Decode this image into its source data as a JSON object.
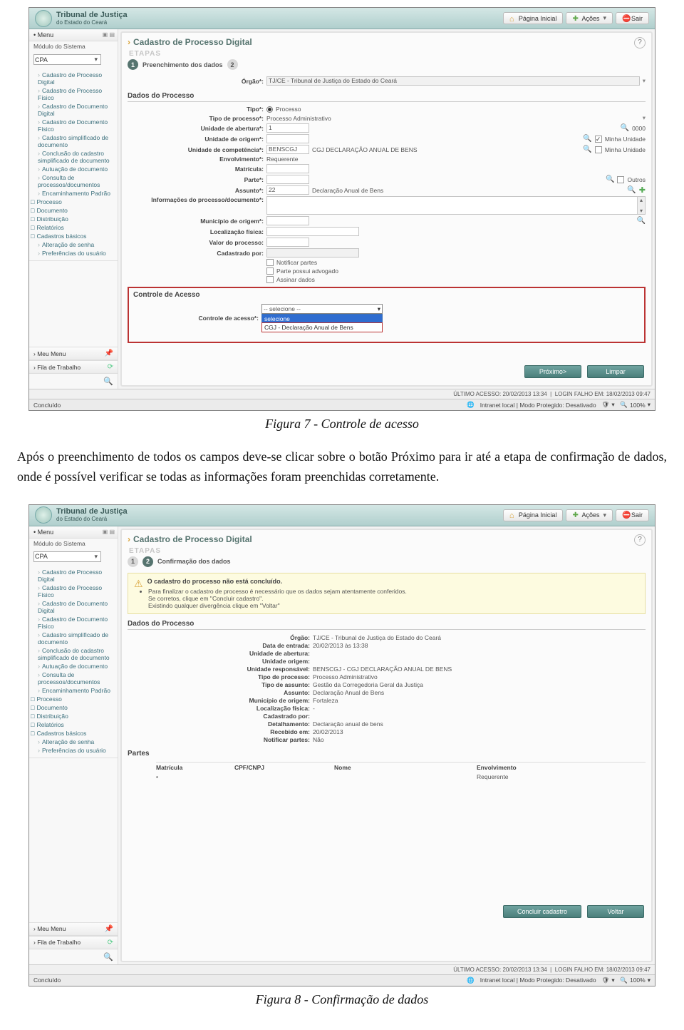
{
  "common": {
    "orgTitle": "Tribunal de Justiça",
    "orgSub": "do Estado do Ceará",
    "btnHome": "Página Inicial",
    "btnAcoes": "Ações",
    "btnSair": "Sair",
    "sbMenu": "Menu",
    "sbModulo": "Módulo do Sistema",
    "sbModuloVal": "CPA",
    "menu": {
      "a": "Cadastro de Processo Digital",
      "b": "Cadastro de Processo Físico",
      "c": "Cadastro de Documento Digital",
      "d": "Cadastro de Documento Físico",
      "e": "Cadastro simplificado de documento",
      "f": "Conclusão do cadastro simplificado de documento",
      "g": "Autuação de documento",
      "h": "Consulta de processos/documentos",
      "i": "Encaminhamento Padrão",
      "j": "Processo",
      "k": "Documento",
      "l": "Distribuição",
      "m": "Relatórios",
      "n": "Cadastros básicos",
      "o": "Alteração de senha",
      "p": "Preferências do usuário"
    },
    "sbMeuMenu": "Meu Menu",
    "sbFila": "Fila de Trabalho",
    "pageTitle": "Cadastro de Processo Digital",
    "etapas": "ETAPAS",
    "statusLeft": "Concluído",
    "statusRight1": "ÚLTIMO ACESSO: 20/02/2013 13:34",
    "statusRight2": "LOGIN FALHO EM: 18/02/2013 09:47",
    "ieMid": "Intranet local | Modo Protegido: Desativado",
    "ieZoom": "100%"
  },
  "fig7": {
    "stepLabel": "Preenchimento dos dados",
    "lblOrgao": "Órgão*:",
    "valOrgao": "TJ/CE - Tribunal de Justiça do Estado do Ceará",
    "secDados": "Dados do Processo",
    "lblTipo": "Tipo*:",
    "valTipo": "Processo",
    "lblTipoProc": "Tipo de processo*:",
    "valTipoProc": "Processo Administrativo",
    "lblUnAb": "Unidade de abertura*:",
    "valUnAb": "1",
    "valUnAbCode": "0000",
    "lblUnOrig": "Unidade de origem*:",
    "lblMinhaUn": "Minha Unidade",
    "lblUnComp": "Unidade de competência*:",
    "valUnComp": "BENSCGJ",
    "valUnCompDesc": "CGJ DECLARAÇÃO ANUAL DE BENS",
    "lblEnvolv": "Envolvimento*:",
    "valEnvolv": "Requerente",
    "lblMatric": "Matrícula:",
    "lblParte": "Parte*:",
    "lblOutros": "Outros",
    "lblAssunto": "Assunto*:",
    "valAssuntoN": "22",
    "valAssuntoD": "Declaração Anual de Bens",
    "lblInfoProc": "Informações do processo/documento*:",
    "lblMunic": "Município de origem*:",
    "lblLocFis": "Localização física:",
    "lblValProc": "Valor do processo:",
    "lblCadPor": "Cadastrado por:",
    "chkNotif": "Notificar partes",
    "chkAdv": "Parte possui advogado",
    "chkAssinar": "Assinar dados",
    "secControle": "Controle de Acesso",
    "lblControle": "Controle de acesso*:",
    "ddSel": "-- selecione --",
    "ddOpt1": "selecione",
    "ddOpt2": "CGJ - Declaração Anual de Bens",
    "btnProx": "Próximo>",
    "btnLimpar": "Limpar",
    "caption": "Figura 7 - Controle de acesso"
  },
  "paragraph": "Após o preenchimento de todos os campos  deve-se clicar sobre o botão Próximo para ir até a etapa de confirmação de dados, onde é possível verificar se todas as informações foram preenchidas corretamente.",
  "fig8": {
    "stepLabel": "Confirmação dos dados",
    "noticeTitle": "O cadastro do processo não está concluído.",
    "noticeL1": "Para finalizar o cadastro de processo é necessário que os dados sejam atentamente conferidos.",
    "noticeL2": "Se corretos, clique em \"Concluir cadastro\".",
    "noticeL3": "Existindo qualquer divergência clique em \"Voltar\"",
    "secDados": "Dados do Processo",
    "rows": {
      "orgao": {
        "k": "Órgão:",
        "v": "TJ/CE - Tribunal de Justiça do Estado do Ceará"
      },
      "dataEnt": {
        "k": "Data de entrada:",
        "v": "20/02/2013 às 13:38"
      },
      "unAb": {
        "k": "Unidade de abertura:",
        "v": ""
      },
      "unOrig": {
        "k": "Unidade origem:",
        "v": ""
      },
      "unResp": {
        "k": "Unidade responsável:",
        "v": "BENSCGJ - CGJ DECLARAÇÃO ANUAL DE BENS"
      },
      "tipoProc": {
        "k": "Tipo de processo:",
        "v": "Processo Administrativo"
      },
      "tipoAss": {
        "k": "Tipo de assunto:",
        "v": "Gestão da Corregedoria Geral da Justiça"
      },
      "assunto": {
        "k": "Assunto:",
        "v": "Declaração Anual de Bens"
      },
      "munic": {
        "k": "Município de origem:",
        "v": "Fortaleza"
      },
      "locFis": {
        "k": "Localização física:",
        "v": "-"
      },
      "cadPor": {
        "k": "Cadastrado por:",
        "v": ""
      },
      "detalh": {
        "k": "Detalhamento:",
        "v": "Declaração anual de bens"
      },
      "receb": {
        "k": "Recebido em:",
        "v": "20/02/2013"
      },
      "notif": {
        "k": "Notificar partes:",
        "v": "Não"
      }
    },
    "secPartes": "Partes",
    "colMat": "Matrícula",
    "colCpf": "CPF/CNPJ",
    "colNome": "Nome",
    "colEnv": "Envolvimento",
    "rowEnv": "Requerente",
    "btnConcluir": "Concluir cadastro",
    "btnVoltar": "Voltar",
    "caption": "Figura 8 - Confirmação de dados"
  }
}
